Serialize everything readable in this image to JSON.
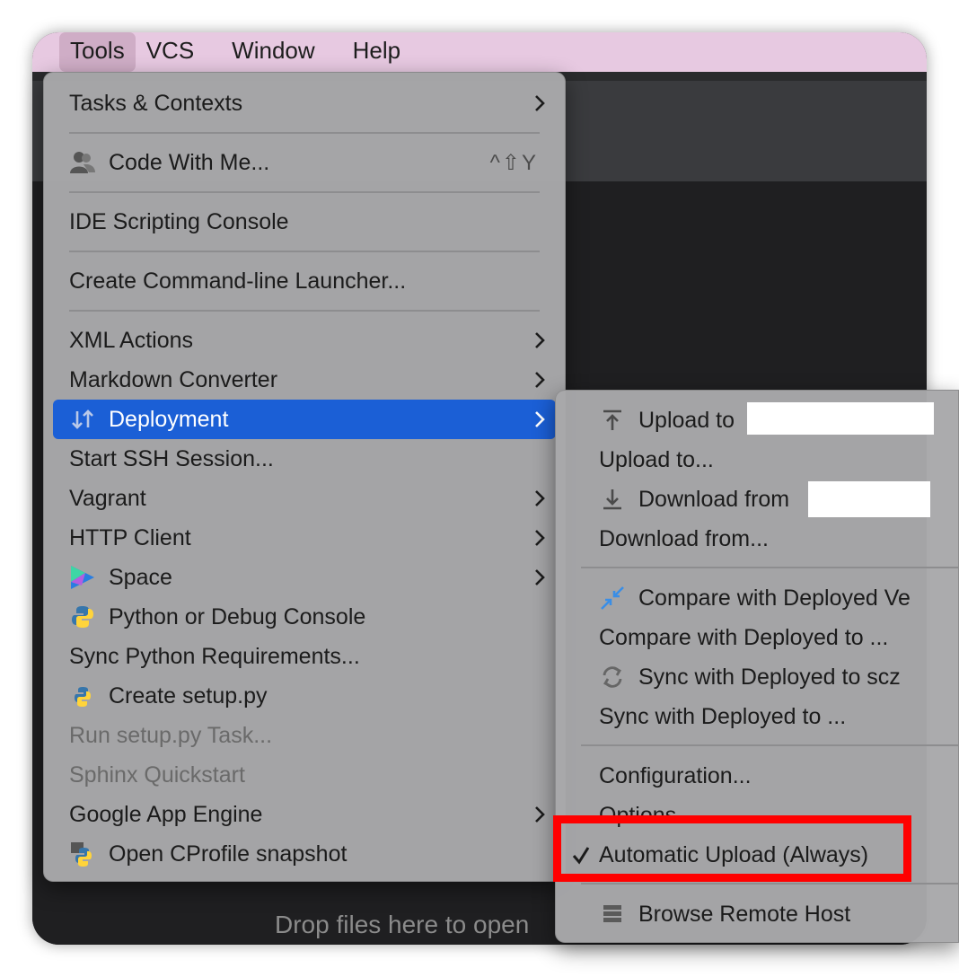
{
  "menubar": {
    "items": [
      "Tools",
      "VCS",
      "Window",
      "Help"
    ]
  },
  "editor": {
    "drop_hint": "Drop files here to open"
  },
  "tools_menu": {
    "tasks_contexts": "Tasks & Contexts",
    "code_with_me": "Code With Me...",
    "code_with_me_shortcut": "^⇧Y",
    "ide_scripting_console": "IDE Scripting Console",
    "create_launcher": "Create Command-line Launcher...",
    "xml_actions": "XML Actions",
    "markdown_converter": "Markdown Converter",
    "deployment": "Deployment",
    "start_ssh": "Start SSH Session...",
    "vagrant": "Vagrant",
    "http_client": "HTTP Client",
    "space": "Space",
    "python_console": "Python or Debug Console",
    "sync_python_req": "Sync Python Requirements...",
    "create_setup": "Create setup.py",
    "run_setup_task": "Run setup.py Task...",
    "sphinx_quickstart": "Sphinx Quickstart",
    "google_app_engine": "Google App Engine",
    "open_cprofile": "Open CProfile snapshot"
  },
  "deployment_menu": {
    "upload_to_server": "Upload to",
    "upload_to": "Upload to...",
    "download_from_server": "Download from",
    "download_from": "Download from...",
    "compare_deployed": "Compare with Deployed Ve",
    "compare_deployed_to": "Compare with Deployed to ...",
    "sync_deployed_server": "Sync with Deployed to scz",
    "sync_deployed_to": "Sync with Deployed to ...",
    "configuration": "Configuration...",
    "options": "Options...",
    "automatic_upload": "Automatic Upload (Always)",
    "automatic_upload_checked": true,
    "browse_remote_host": "Browse Remote Host"
  },
  "colors": {
    "highlight": "#1b5fd6",
    "annotation_box": "#ff0000",
    "menubar_bg": "#e7c9e1"
  }
}
